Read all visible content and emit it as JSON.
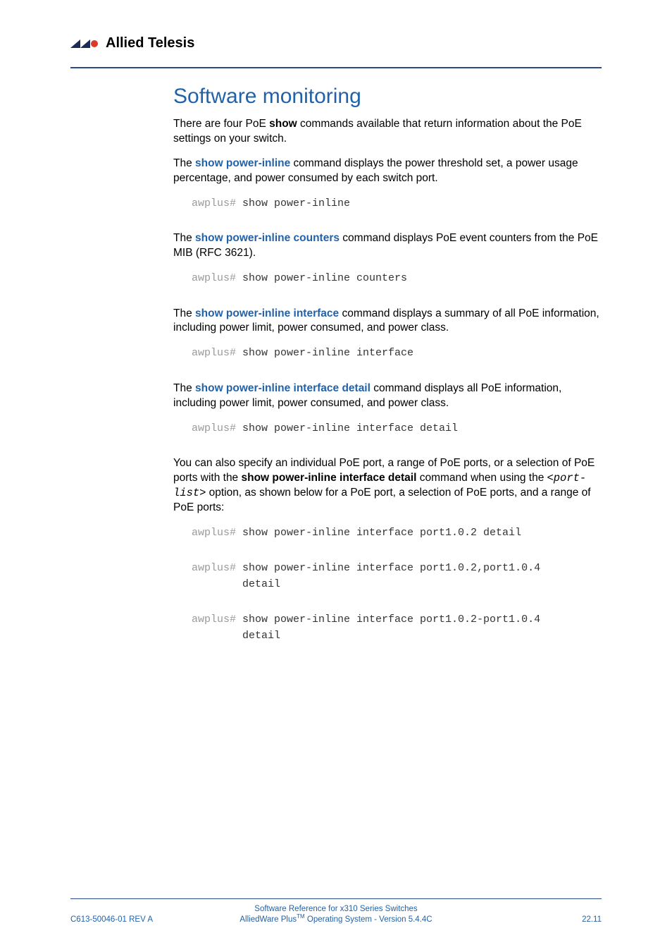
{
  "header": {
    "brand": "Allied Telesis"
  },
  "section": {
    "title": "Software monitoring",
    "intro_a": "There are four PoE ",
    "intro_b": "show",
    "intro_c": " commands available that return information about the PoE settings on your switch.",
    "p1_a": "The ",
    "p1_link": "show power-inline",
    "p1_b": " command displays the power threshold set, a power usage percentage, and power consumed by each switch port.",
    "cmd1_prompt": "awplus#",
    "cmd1": "show power-inline",
    "p2_a": "The ",
    "p2_link": "show power-inline counters",
    "p2_b": " command displays PoE event counters from the PoE MIB (RFC 3621).",
    "cmd2_prompt": "awplus#",
    "cmd2": "show power-inline counters",
    "p3_a": "The ",
    "p3_link": "show power-inline interface",
    "p3_b": " command displays a summary of all PoE information, including power limit, power consumed, and power class.",
    "cmd3_prompt": "awplus#",
    "cmd3": "show power-inline interface",
    "p4_a": "The ",
    "p4_link": "show power-inline interface detail",
    "p4_b": " command displays all PoE information, including power limit, power consumed, and power class.",
    "cmd4_prompt": "awplus#",
    "cmd4": "show power-inline interface detail",
    "p5_a": "You can also specify an individual PoE port, a range of PoE ports, or a selection of PoE ports with the ",
    "p5_bold": "show power-inline interface detail",
    "p5_b": " command when using the <",
    "p5_mono": "port-list",
    "p5_c": "> option, as shown below for a PoE port, a selection of PoE ports, and a range of PoE ports:",
    "cmd5a_prompt": "awplus#",
    "cmd5a": "show power-inline interface port1.0.2 detail",
    "cmd5b_prompt": "awplus#",
    "cmd5b": "show power-inline interface port1.0.2,port1.0.4 \ndetail",
    "cmd5c_prompt": "awplus#",
    "cmd5c": "show power-inline interface port1.0.2-port1.0.4 \ndetail"
  },
  "footer": {
    "left": "C613-50046-01 REV A",
    "center1": "Software Reference for x310 Series Switches",
    "center2_a": "AlliedWare Plus",
    "center2_tm": "TM",
    "center2_b": " Operating System - Version 5.4.4C",
    "right": "22.11"
  }
}
